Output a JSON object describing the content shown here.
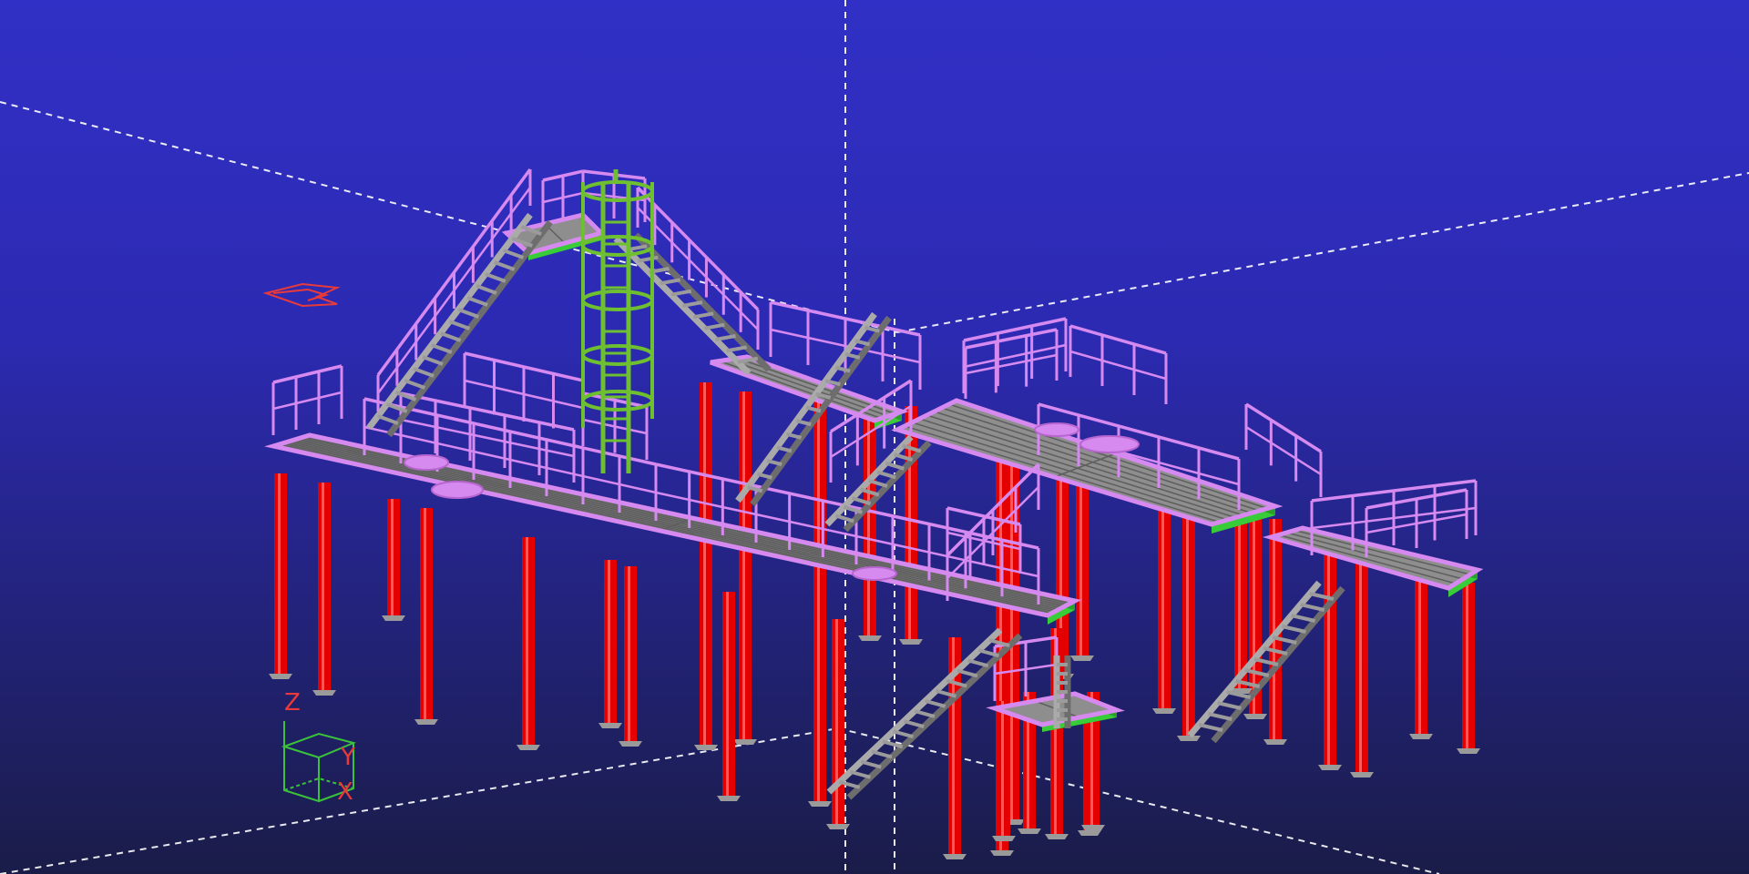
{
  "viewport": {
    "background_top": "#3130c6",
    "background_bottom": "#1a1c48"
  },
  "colors": {
    "column": "#e40000",
    "column_base": "#9a9a9a",
    "handrail": "#d68af0",
    "grating": "#8e8e8e",
    "grating_line": "#5e5e5e",
    "edge_beam": "#38cc38",
    "cage_ladder": "#6ec030",
    "stair": "#aaaaaa",
    "stair_dark": "#6d6d6d",
    "grid_line": "#ffffff",
    "axis_red": "#e83a3a",
    "axis_green": "#3ac23a"
  },
  "axis_indicator": {
    "z_label": "Z",
    "y_label": "Y",
    "x_label": "X"
  },
  "view_cues": {
    "view_direction_arrow": "left-arrow-icon"
  }
}
